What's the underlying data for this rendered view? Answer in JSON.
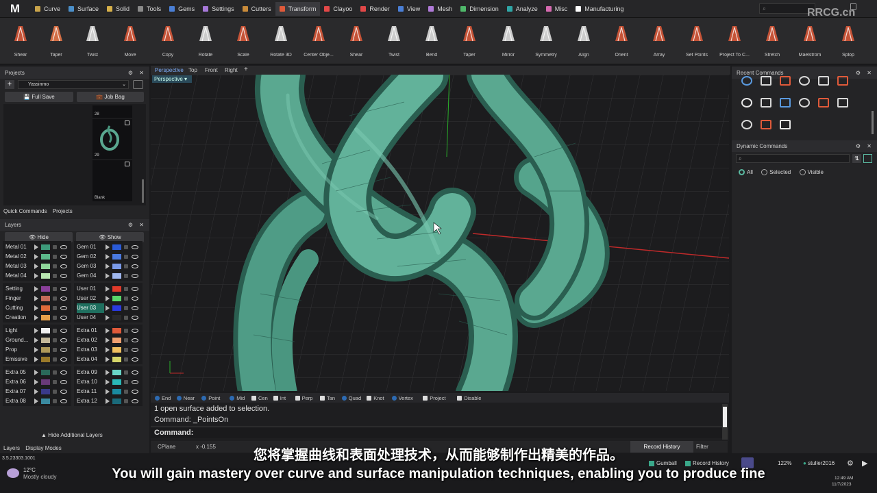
{
  "app": {
    "logo": "M",
    "watermark": "RRCG.cn"
  },
  "menu": {
    "tabs": [
      {
        "label": "Curve",
        "color": "#c9a44b"
      },
      {
        "label": "Surface",
        "color": "#4b8fc9"
      },
      {
        "label": "Solid",
        "color": "#d6b04a"
      },
      {
        "label": "Tools",
        "color": "#8a8a8a"
      },
      {
        "label": "Gems",
        "color": "#4a7fd6"
      },
      {
        "label": "Settings",
        "color": "#a678d8"
      },
      {
        "label": "Cutters",
        "color": "#c98b3a"
      },
      {
        "label": "Transform",
        "color": "#e05a3a"
      },
      {
        "label": "Clayoo",
        "color": "#e24848"
      },
      {
        "label": "Render",
        "color": "#e24848"
      },
      {
        "label": "View",
        "color": "#4a7fd6"
      },
      {
        "label": "Mesh",
        "color": "#b07ad8"
      },
      {
        "label": "Dimension",
        "color": "#4fb86a"
      },
      {
        "label": "Analyze",
        "color": "#2fa6a6"
      },
      {
        "label": "Misc",
        "color": "#d66ab0"
      },
      {
        "label": "Manufacturing",
        "color": "#ffffff"
      }
    ],
    "active": "Transform",
    "search_icon": "search-icon"
  },
  "toolbar": {
    "tools": [
      "Shear",
      "Taper",
      "Twist",
      "Move",
      "Copy",
      "Rotate",
      "Scale",
      "Rotate 3D",
      "Center Obje...",
      "Shear",
      "Twist",
      "Bend",
      "Taper",
      "Mirror",
      "Symmetry",
      "Align",
      "Orient",
      "Array",
      "Set Points",
      "Project To C...",
      "Stretch",
      "Maelstrom",
      "Splop"
    ]
  },
  "projects": {
    "title": "Projects",
    "project_name": "Yassinmo",
    "full_save": "Full Save",
    "job_bag": "Job Bag",
    "thumbs": [
      {
        "num": "28"
      },
      {
        "num": "29"
      },
      {
        "num": "Blank"
      }
    ],
    "tabs": [
      "Quick Commands",
      "Projects"
    ]
  },
  "layers": {
    "title": "Layers",
    "hide": "Hide",
    "show": "Show",
    "left_groups": [
      [
        {
          "name": "Metal 01",
          "color": "#3d9a7a"
        },
        {
          "name": "Metal 02",
          "color": "#5cb88a"
        },
        {
          "name": "Metal 03",
          "color": "#8fd69a"
        },
        {
          "name": "Metal 04",
          "color": "#b8e6b0"
        }
      ],
      [
        {
          "name": "Setting",
          "color": "#8a3f9a"
        },
        {
          "name": "Finger",
          "color": "#c46a5a"
        },
        {
          "name": "Cutting",
          "color": "#e06a3a"
        },
        {
          "name": "Creation",
          "color": "#e8a04a"
        }
      ],
      [
        {
          "name": "Light",
          "color": "#f0f0f0"
        },
        {
          "name": "Ground...",
          "color": "#c4b89a"
        },
        {
          "name": "Prop",
          "color": "#b09a5a"
        },
        {
          "name": "Emissive",
          "color": "#9a7a2a"
        }
      ],
      [
        {
          "name": "Extra 05",
          "color": "#2a6a5a"
        },
        {
          "name": "Extra 06",
          "color": "#6a3a7a"
        },
        {
          "name": "Extra 07",
          "color": "#3a3a8a"
        },
        {
          "name": "Extra 08",
          "color": "#3a8aa0"
        }
      ]
    ],
    "right_groups": [
      [
        {
          "name": "Gem 01",
          "color": "#2a5ad6"
        },
        {
          "name": "Gem 02",
          "color": "#4a7ae0"
        },
        {
          "name": "Gem 03",
          "color": "#7a9ae8"
        },
        {
          "name": "Gem 04",
          "color": "#a0b8f0"
        }
      ],
      [
        {
          "name": "User 01",
          "color": "#e03a2a"
        },
        {
          "name": "User 02",
          "color": "#5ad66a"
        },
        {
          "name": "User 03",
          "color": "#2a3ae0",
          "selected": true
        },
        {
          "name": "User 04",
          "color": "#2a2a2a"
        }
      ],
      [
        {
          "name": "Extra 01",
          "color": "#e05a3a"
        },
        {
          "name": "Extra 02",
          "color": "#f0a070"
        },
        {
          "name": "Extra 03",
          "color": "#f0c060"
        },
        {
          "name": "Extra 04",
          "color": "#d6d66a"
        }
      ],
      [
        {
          "name": "Extra 09",
          "color": "#6ad6c8"
        },
        {
          "name": "Extra 10",
          "color": "#2ab8b8"
        },
        {
          "name": "Extra 11",
          "color": "#1a8aa0"
        },
        {
          "name": "Extra 12",
          "color": "#1a6a7a"
        }
      ]
    ],
    "hide_additional": "Hide Additional Layers",
    "tabs": [
      "Layers",
      "Display Modes"
    ]
  },
  "viewport": {
    "tabs": [
      "Perspective",
      "Top",
      "Front",
      "Right",
      "+"
    ],
    "label": "Perspective",
    "model_color": "#5aa890"
  },
  "osnap": {
    "items": [
      {
        "label": "End",
        "on": true
      },
      {
        "label": "Near",
        "on": true
      },
      {
        "label": "Point",
        "on": true
      },
      {
        "label": "Mid",
        "on": true
      },
      {
        "label": "Cen",
        "on": false
      },
      {
        "label": "Int",
        "on": false
      },
      {
        "label": "Perp",
        "on": false
      },
      {
        "label": "Tan",
        "on": false
      },
      {
        "label": "Quad",
        "on": true
      },
      {
        "label": "Knot",
        "on": false
      },
      {
        "label": "Vertex",
        "on": true
      },
      {
        "label": "Project",
        "on": false
      },
      {
        "label": "Disable",
        "on": false
      }
    ]
  },
  "command": {
    "lines": [
      "1 open surface added to selection.",
      "Command: _PointsOn"
    ],
    "prompt": "Command:"
  },
  "status": {
    "cplane": "CPlane",
    "coord": "x -0.155",
    "record_history": "Record History",
    "filter": "Filter"
  },
  "recent_commands": {
    "title": "Recent Commands"
  },
  "dynamic_commands": {
    "title": "Dynamic Commands",
    "options": [
      "All",
      "Selected",
      "Visible"
    ],
    "selected": "All"
  },
  "taskbar": {
    "version": "3.5.23303.1001",
    "temp": "12°C",
    "weather": "Mostly cloudy",
    "gumball": "Gumball",
    "record_history": "Record History",
    "zoom": "122%",
    "user": "stuller2016",
    "time": "12:49 AM",
    "date": "11/7/2023"
  },
  "subtitle": {
    "cn": "您将掌握曲线和表面处理技术，从而能够制作出精美的作品。",
    "en": "You will gain mastery over curve and surface manipulation techniques, enabling you to produce fine"
  }
}
